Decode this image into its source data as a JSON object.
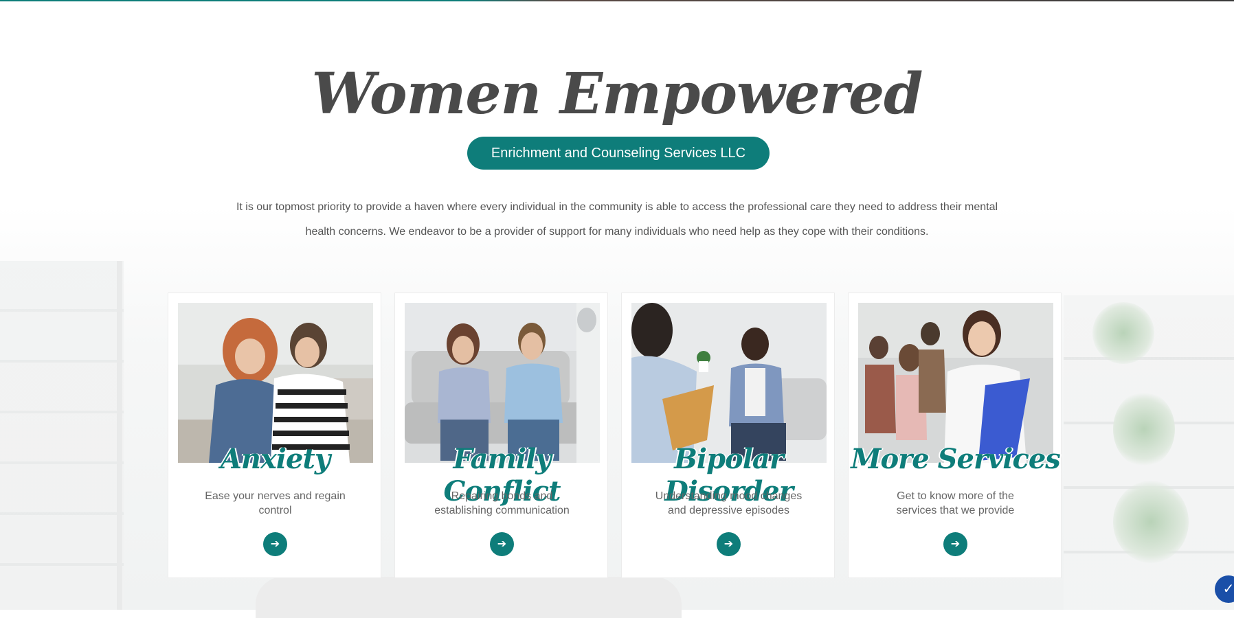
{
  "header": {
    "title": "Women Empowered",
    "subtitle": "Enrichment and Counseling Services LLC"
  },
  "intro": {
    "line1": "It is our topmost priority to provide a haven where every individual in the community is able to access the professional care they need to address their mental",
    "line2": "health concerns. We endeavor to be a provider of support for many individuals who need help as they cope with their conditions."
  },
  "services": [
    {
      "title": "Anxiety",
      "description": "Ease your nerves and regain control",
      "icon": "arrow-right-icon"
    },
    {
      "title": "Family Conflict",
      "description": "Repairing bonds and establishing communication",
      "icon": "arrow-right-icon"
    },
    {
      "title": "Bipolar Disorder",
      "description": "Understanding mood changes and depressive episodes",
      "icon": "arrow-right-icon"
    },
    {
      "title": "More Services",
      "description": "Get to know more of the services that we provide",
      "icon": "arrow-right-icon"
    }
  ],
  "colors": {
    "accent": "#0e7d7a",
    "title_text": "#4a4a4a",
    "accessibility_button": "#1a4fa8"
  },
  "accessibility": {
    "icon": "accessibility-icon"
  }
}
